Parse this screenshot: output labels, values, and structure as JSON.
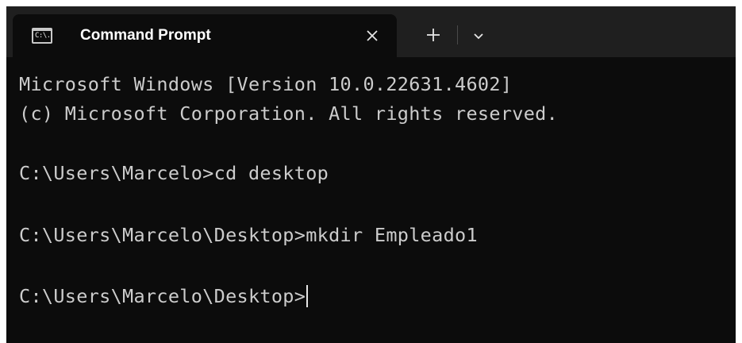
{
  "tab": {
    "icon_text": "C:\\.",
    "title": "Command Prompt",
    "close_label": "✕",
    "new_tab_label": "+",
    "dropdown_label": "⌄"
  },
  "console": {
    "lines": [
      "Microsoft Windows [Version 10.0.22631.4602]",
      "(c) Microsoft Corporation. All rights reserved.",
      "",
      "C:\\Users\\Marcelo>cd desktop",
      "",
      "C:\\Users\\Marcelo\\Desktop>mkdir Empleado1",
      "",
      "C:\\Users\\Marcelo\\Desktop>"
    ]
  },
  "colors": {
    "titlebar": "#1f1f1f",
    "console_bg": "#0c0c0c",
    "console_text": "#cccccc"
  }
}
